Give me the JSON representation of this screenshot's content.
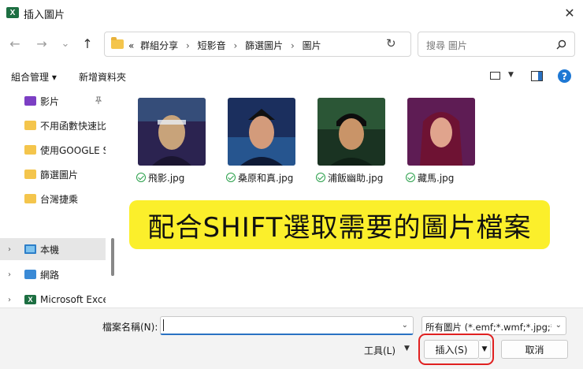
{
  "window": {
    "title": "插入圖片",
    "close_glyph": "✕"
  },
  "nav": {
    "back": "←",
    "forward": "→",
    "recent": "⌄",
    "up": "↑",
    "breadcrumb": [
      "«",
      "群組分享",
      "短影音",
      "篩選圖片",
      "圖片"
    ],
    "breadcrumb_sep": "›",
    "refresh": "↻",
    "search_placeholder": "搜尋 圖片",
    "search_glyph": "⌕"
  },
  "toolbar": {
    "organize": "組合管理 ▾",
    "new_folder": "新增資料夾",
    "view_drop": "▼",
    "help": "?"
  },
  "sidebar": {
    "items": [
      {
        "label": "影片",
        "icon": "videos-icon",
        "pinned": true
      },
      {
        "label": "不用函數快速比",
        "icon": "folder-icon"
      },
      {
        "label": "使用GOOGLE S",
        "icon": "folder-icon"
      },
      {
        "label": "篩選圖片",
        "icon": "folder-icon"
      },
      {
        "label": "台灣捷乘",
        "icon": "folder-icon"
      },
      {
        "label": "本機",
        "icon": "pc-icon",
        "expandable": true
      },
      {
        "label": "網路",
        "icon": "network-icon",
        "expandable": true
      },
      {
        "label": "Microsoft Excel",
        "icon": "excel-icon",
        "expandable": true
      }
    ],
    "pin_glyph": "📌",
    "chev": "›"
  },
  "files": [
    {
      "name": "飛影.jpg",
      "palette": [
        "#2b2350",
        "#3b5f8a",
        "#c8a37a"
      ]
    },
    {
      "name": "桑原和真.jpg",
      "palette": [
        "#1b2f5e",
        "#2e6fb0",
        "#d39b7b"
      ]
    },
    {
      "name": "浦飯幽助.jpg",
      "palette": [
        "#1a3322",
        "#3b7a4a",
        "#c99468"
      ]
    },
    {
      "name": "藏馬.jpg",
      "palette": [
        "#3a1640",
        "#a4287a",
        "#e0a48d"
      ]
    }
  ],
  "annotation": {
    "text": "配合SHIFT選取需要的圖片檔案",
    "color": "#fbef2b"
  },
  "bottom": {
    "filename_label": "檔案名稱(N):",
    "filename_value": "",
    "filter_value": "所有圖片 (*.emf;*.wmf;*.jpg;*.jp",
    "tools": "工具(L)",
    "tools_chev": "▼",
    "insert": "插入(S)",
    "insert_split": "▼",
    "cancel": "取消",
    "highlight_color": "#e02020"
  }
}
